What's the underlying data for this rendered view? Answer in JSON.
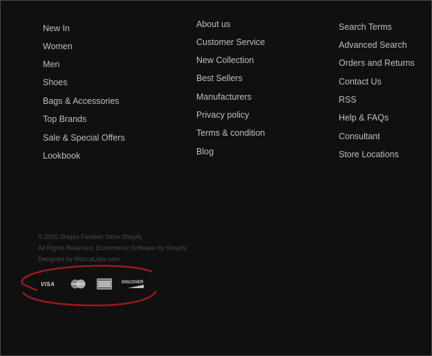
{
  "footer": {
    "col1": [
      "New In",
      "Women",
      "Men",
      "Shoes",
      "Bags & Accessories",
      "Top Brands",
      "Sale & Special Offers",
      "Lookbook"
    ],
    "col2": [
      "About us",
      "Customer Service",
      "New Collection",
      "Best Sellers",
      "Manufacturers",
      "Privacy policy",
      "Terms & condition",
      "Blog"
    ],
    "col3": [
      "Search Terms",
      "Advanced Search",
      "Orders and Returns",
      "Contact Us",
      "RSS",
      "Help & FAQs",
      "Consultant",
      "Store Locations"
    ]
  },
  "copyright": {
    "line1": "© 2015  Shopia  Fashion Store Shopify",
    "line2": "All Rights Reserved. Ecommerce Software by Shopify.",
    "line3": "Designed by  MoccaLabs.com"
  },
  "payments": {
    "visa": "VISA",
    "discover": "DISCOVER"
  },
  "colors": {
    "background": "#101010",
    "link": "#bfbfbf",
    "copyright": "#4a4a4a",
    "annotation": "#9b1b1b"
  },
  "icons": [
    "visa-icon",
    "mastercard-icon",
    "amex-icon",
    "discover-icon"
  ]
}
